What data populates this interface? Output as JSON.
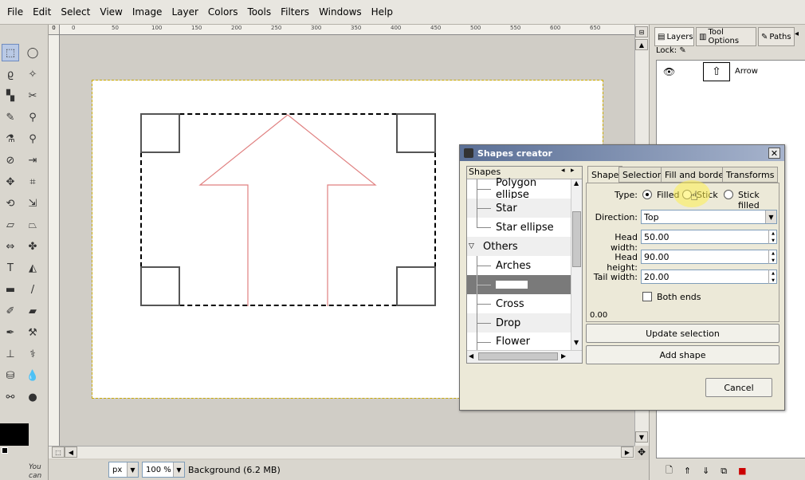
{
  "menubar": {
    "items": [
      "File",
      "Edit",
      "Select",
      "View",
      "Image",
      "Layer",
      "Colors",
      "Tools",
      "Filters",
      "Windows",
      "Help"
    ]
  },
  "toolbox": {
    "icons": [
      "rect-select-icon",
      "ellipse-select-icon",
      "free-select-icon",
      "fuzzy-select-icon",
      "color-select-icon",
      "scissors-icon",
      "paths-icon",
      "zoom-icon",
      "color-picker-icon",
      "measure-icon",
      "move-icon",
      "align-icon",
      "crop-icon",
      "rotate-icon",
      "scale-icon",
      "shear-icon",
      "perspective-icon",
      "flip-icon",
      "text-icon",
      "bucket-fill-icon",
      "blend-icon",
      "pencil-icon",
      "paintbrush-icon",
      "eraser-icon",
      "airbrush-icon",
      "ink-icon",
      "clone-icon",
      "heal-icon",
      "perspective-clone-icon",
      "blur-icon",
      "smudge-icon",
      "dodge-icon"
    ],
    "hint": "You can"
  },
  "rulers": {
    "corner_label": "0",
    "top_ticks": [
      "0",
      "50",
      "100",
      "150",
      "200",
      "250",
      "300",
      "350",
      "400",
      "450",
      "500",
      "550",
      "600",
      "650"
    ]
  },
  "statusbar": {
    "unit": "px",
    "zoom": "100 %",
    "layer_info": "Background (6.2 MB)"
  },
  "dock": {
    "tabs": [
      "Layers",
      "Tool Options",
      "Paths"
    ],
    "lock_label": "Lock:",
    "layer": {
      "name": "Arrow",
      "thumb_glyph": "⇧"
    }
  },
  "dialog": {
    "title": "Shapes creator",
    "close": "✕",
    "tree": {
      "header": "Shapes",
      "rows": [
        {
          "label": "Polygon ellipse",
          "type": "child"
        },
        {
          "label": "Star",
          "type": "child"
        },
        {
          "label": "Star ellipse",
          "type": "child"
        },
        {
          "label": "Others",
          "type": "group"
        },
        {
          "label": "Arches",
          "type": "child"
        },
        {
          "label": "",
          "type": "child-selected"
        },
        {
          "label": "Cross",
          "type": "child"
        },
        {
          "label": "Drop",
          "type": "child"
        },
        {
          "label": "Flower",
          "type": "child"
        }
      ]
    },
    "tabs": [
      "Shape",
      "Selection",
      "Fill and border",
      "Transforms"
    ],
    "active_tab": "Shape",
    "form": {
      "type_label": "Type:",
      "type_options": [
        "Filled",
        "Stick",
        "Stick filled"
      ],
      "type_selected": "Filled",
      "direction_label": "Direction:",
      "direction_value": "Top",
      "head_width_label": "Head width:",
      "head_width_value": "50.00",
      "head_height_label": "Head height:",
      "head_height_value": "90.00",
      "tail_width_label": "Tail width:",
      "tail_width_value": "20.00",
      "both_ends_label": "Both ends",
      "both_ends_checked": false,
      "footer_value": "0.00"
    },
    "buttons": {
      "update": "Update selection",
      "add": "Add shape",
      "cancel": "Cancel"
    }
  },
  "colors": {
    "arrow_stroke": "#e08080",
    "selection_border": "#d8c000",
    "title_bar_left": "#5a6f96",
    "tree_selected": "#7a7a7a"
  }
}
